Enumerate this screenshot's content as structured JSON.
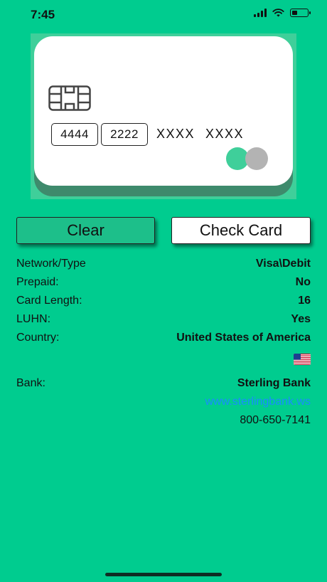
{
  "status_bar": {
    "time": "7:45"
  },
  "card": {
    "number_groups": [
      "4444",
      "2222",
      "XXXX",
      "XXXX"
    ],
    "icons": [
      "chip-icon",
      "card-brand-logo"
    ]
  },
  "buttons": {
    "clear": "Clear",
    "check": "Check Card"
  },
  "info": {
    "network_label": "Network/Type",
    "network_value": "Visa\\Debit",
    "prepaid_label": "Prepaid:",
    "prepaid_value": "No",
    "length_label": "Card Length:",
    "length_value": "16",
    "luhn_label": "LUHN:",
    "luhn_value": "Yes",
    "country_label": "Country:",
    "country_value": "United States of America",
    "country_flag_icon": "us-flag-icon",
    "bank_label": "Bank:",
    "bank_value": "Sterling Bank",
    "bank_url": "www.sterlingbank.ws",
    "bank_phone": "800-650-7141"
  },
  "colors": {
    "background": "#00cc8f",
    "link": "#1a8cff",
    "button_clear": "#1dbf8a"
  }
}
